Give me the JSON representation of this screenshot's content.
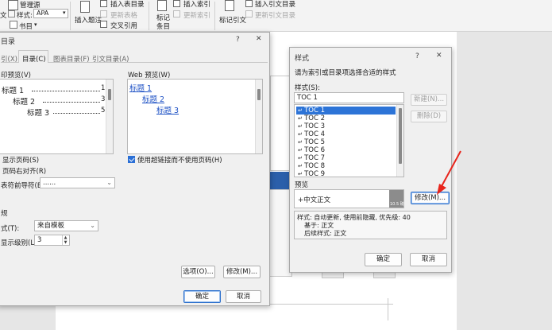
{
  "ribbon": {
    "manage_sources": "管理源",
    "style_label": "样式:",
    "style_value": "APA",
    "text_fragment": "文",
    "bibliography": "书目",
    "insert_caption_line1": "插入题注",
    "insert_table_of_figures": "插入表目录",
    "update_table": "更新表格",
    "cross_reference": "交叉引用",
    "mark_entry_line1": "标记",
    "mark_entry_line2": "条目",
    "insert_index": "插入索引",
    "update_index": "更新索引",
    "mark_citation": "标记引文",
    "insert_table_of_authorities": "插入引文目录",
    "update_table_of_authorities": "更新引文目录"
  },
  "toc_dialog": {
    "title": "目录",
    "help": "?",
    "close": "✕",
    "tabs": [
      "引(X)",
      "目录(C)",
      "图表目录(F)",
      "引文目录(A)"
    ],
    "print_preview_label": "印预览(V)",
    "print_preview": [
      {
        "text": "标题 1",
        "page": "1"
      },
      {
        "text": "标题 2",
        "page": "3"
      },
      {
        "text": "标题 3",
        "page": "5"
      }
    ],
    "web_preview_label": "Web 预览(W)",
    "web_preview": [
      "标题 1",
      "标题 2",
      "标题 3"
    ],
    "show_page_numbers": "显示页码(S)",
    "right_align": "页码右对齐(R)",
    "tab_leader_label": "表符前导符(B):",
    "tab_leader_value": "......",
    "use_hyperlinks": "使用超链接而不使用页码(H)",
    "general_label": "规",
    "formats_label": "式(T):",
    "formats_value": "来自模板",
    "show_levels_label": "显示级别(L):",
    "show_levels_value": "3",
    "options_button": "选项(O)...",
    "modify_button": "修改(M)...",
    "ok_button": "确定",
    "cancel_button": "取消"
  },
  "style_dialog": {
    "title": "样式",
    "help": "?",
    "close": "✕",
    "instruction": "请为索引或目录项选择合适的样式",
    "styles_label": "样式(S):",
    "style_input": "TOC 1",
    "styles": [
      "TOC 1",
      "TOC 2",
      "TOC 3",
      "TOC 4",
      "TOC 5",
      "TOC 6",
      "TOC 7",
      "TOC 8",
      "TOC 9"
    ],
    "new_button": "新建(N)...",
    "delete_button": "删除(D)",
    "preview_label": "预览",
    "preview_text": "+中文正文",
    "preview_size": "10.5 磅",
    "modify_button": "修改(M)...",
    "description": [
      "样式: 自动更新, 使用前隐藏, 优先级: 40",
      "基于: 正文",
      "后续样式: 正文"
    ],
    "ok_button": "确定",
    "cancel_button": "取消"
  },
  "colors": {
    "accent": "#2d74d7",
    "arrow": "#e8251c",
    "link": "#1b4fc4"
  }
}
